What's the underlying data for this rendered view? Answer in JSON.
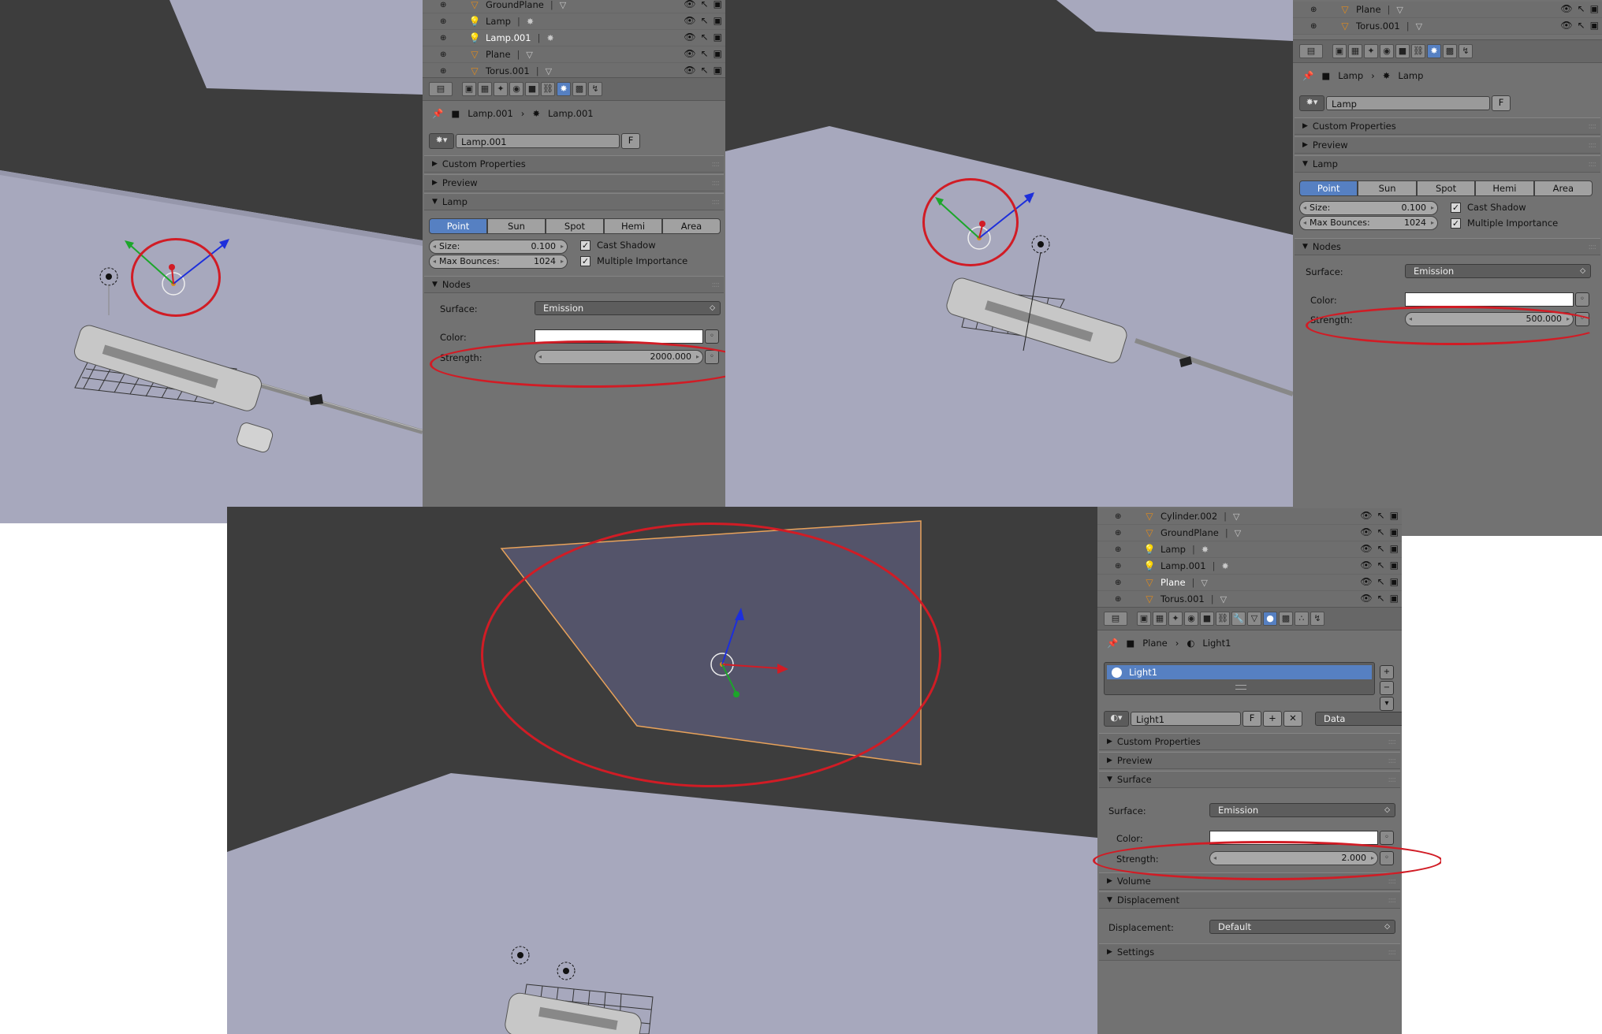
{
  "panel_a": {
    "outliner": [
      {
        "name": "GroundPlane",
        "icon": "mesh-icon"
      },
      {
        "name": "Lamp",
        "icon": "lamp-icon"
      },
      {
        "name": "Lamp.001",
        "icon": "lamp-icon",
        "highlight": true
      },
      {
        "name": "Plane",
        "icon": "mesh-icon"
      },
      {
        "name": "Torus.001",
        "icon": "mesh-icon"
      }
    ],
    "breadcrumb": {
      "object": "Lamp.001",
      "data": "Lamp.001"
    },
    "name_field": "Lamp.001",
    "fake_user": "F",
    "sections": {
      "custom": "Custom Properties",
      "preview": "Preview",
      "lamp": "Lamp",
      "nodes": "Nodes"
    },
    "lamp_types": [
      "Point",
      "Sun",
      "Spot",
      "Hemi",
      "Area"
    ],
    "size_label": "Size:",
    "size_value": "0.100",
    "bounces_label": "Max Bounces:",
    "bounces_value": "1024",
    "cast_shadow": "Cast Shadow",
    "multiple_importance": "Multiple Importance",
    "surface_label": "Surface:",
    "surface_value": "Emission",
    "color_label": "Color:",
    "strength_label": "Strength:",
    "strength_value": "2000.000"
  },
  "panel_b": {
    "outliner": [
      {
        "name": "Plane",
        "icon": "mesh-icon"
      },
      {
        "name": "Torus.001",
        "icon": "mesh-icon"
      }
    ],
    "breadcrumb": {
      "object": "Lamp",
      "data": "Lamp"
    },
    "name_field": "Lamp",
    "fake_user": "F",
    "sections": {
      "custom": "Custom Properties",
      "preview": "Preview",
      "lamp": "Lamp",
      "nodes": "Nodes"
    },
    "lamp_types": [
      "Point",
      "Sun",
      "Spot",
      "Hemi",
      "Area"
    ],
    "size_label": "Size:",
    "size_value": "0.100",
    "bounces_label": "Max Bounces:",
    "bounces_value": "1024",
    "cast_shadow": "Cast Shadow",
    "multiple_importance": "Multiple Importance",
    "surface_label": "Surface:",
    "surface_value": "Emission",
    "color_label": "Color:",
    "strength_label": "Strength:",
    "strength_value": "500.000"
  },
  "panel_c": {
    "outliner": [
      {
        "name": "Cylinder.002",
        "icon": "mesh-icon"
      },
      {
        "name": "GroundPlane",
        "icon": "mesh-icon"
      },
      {
        "name": "Lamp",
        "icon": "lamp-icon"
      },
      {
        "name": "Lamp.001",
        "icon": "lamp-icon"
      },
      {
        "name": "Plane",
        "icon": "mesh-icon",
        "highlight": true
      },
      {
        "name": "Torus.001",
        "icon": "mesh-icon"
      }
    ],
    "breadcrumb": {
      "object": "Plane",
      "data": "Light1"
    },
    "material_slot": "Light1",
    "name_field": "Light1",
    "fake_user": "F",
    "link_value": "Data",
    "sections": {
      "custom": "Custom Properties",
      "preview": "Preview",
      "surface": "Surface",
      "volume": "Volume",
      "displacement": "Displacement",
      "settings": "Settings"
    },
    "surface_label": "Surface:",
    "surface_value": "Emission",
    "color_label": "Color:",
    "strength_label": "Strength:",
    "strength_value": "2.000",
    "displacement_label": "Displacement:",
    "displacement_value": "Default"
  },
  "colors": {
    "highlight": "#d11c25",
    "active_blue": "#5680c2",
    "floor": "#a7a8bd",
    "background": "#3d3d3d"
  }
}
